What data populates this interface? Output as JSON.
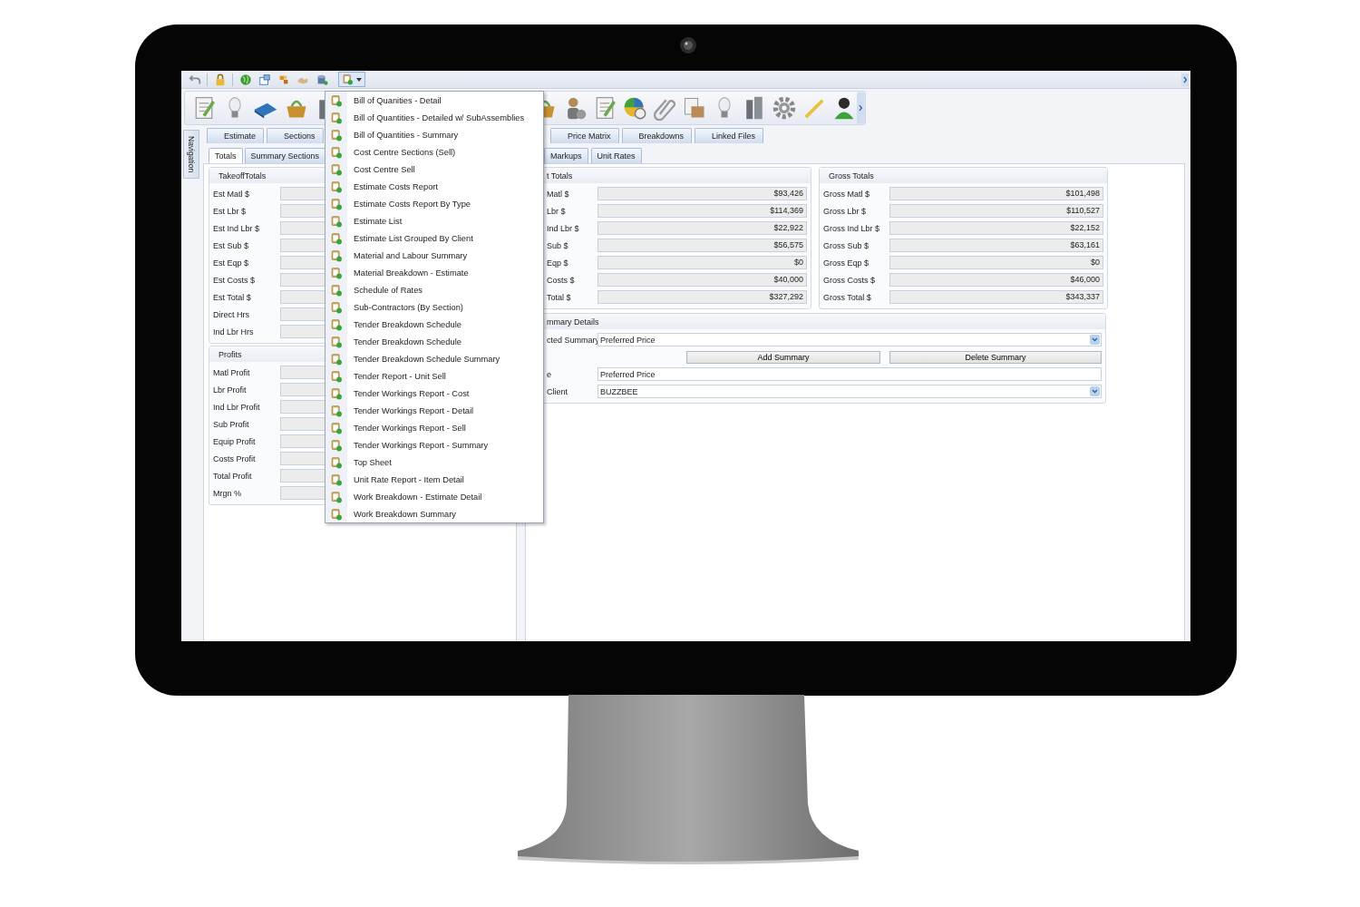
{
  "report_menu": {
    "expanded": true,
    "items": [
      {
        "label": "Bill of Quanities - Detail"
      },
      {
        "label": "Bill of Quantities - Detailed w/ SubAssemblies"
      },
      {
        "label": "Bill of Quantities - Summary"
      },
      {
        "label": "Cost Centre Sections (Sell)"
      },
      {
        "label": "Cost Centre Sell"
      },
      {
        "label": "Estimate Costs Report"
      },
      {
        "label": "Estimate Costs Report By Type"
      },
      {
        "label": "Estimate List"
      },
      {
        "label": "Estimate List Grouped By Client"
      },
      {
        "label": "Material and Labour Summary"
      },
      {
        "label": "Material Breakdown - Estimate"
      },
      {
        "label": "Schedule of Rates"
      },
      {
        "label": "Sub-Contractors (By Section)"
      },
      {
        "label": "Tender Breakdown Schedule"
      },
      {
        "label": "Tender Breakdown Schedule"
      },
      {
        "label": "Tender Breakdown Schedule Summary"
      },
      {
        "label": "Tender Report - Unit Sell"
      },
      {
        "label": "Tender Workings Report - Cost"
      },
      {
        "label": "Tender Workings Report - Detail"
      },
      {
        "label": "Tender Workings Report - Sell"
      },
      {
        "label": "Tender Workings Report - Summary"
      },
      {
        "label": "Top Sheet"
      },
      {
        "label": "Unit Rate Report - Item Detail"
      },
      {
        "label": "Work Breakdown - Estimate Detail"
      },
      {
        "label": "Work Breakdown Summary"
      }
    ]
  },
  "navigation_tab": "Navigation",
  "main_tabs_left": [
    {
      "label": "Estimate",
      "selected": false
    },
    {
      "label": "Sections",
      "selected": false
    }
  ],
  "main_tabs_right": [
    {
      "label": "Price Matrix",
      "selected": false
    },
    {
      "label": "Breakdowns",
      "selected": false
    },
    {
      "label": "Linked Files",
      "selected": false
    }
  ],
  "sub_tabs_left": [
    {
      "label": "Totals",
      "selected": true
    },
    {
      "label": "Summary Sections",
      "selected": false
    }
  ],
  "sub_tabs_right": [
    {
      "label": "Markups",
      "selected": false
    },
    {
      "label": "Unit Rates",
      "selected": false
    }
  ],
  "takeoff_totals": {
    "title": "TakeoffTotals",
    "fields": [
      {
        "label": "Est Matl $"
      },
      {
        "label": "Est Lbr $"
      },
      {
        "label": "Est Ind Lbr $"
      },
      {
        "label": "Est Sub $"
      },
      {
        "label": "Est Eqp $"
      },
      {
        "label": "Est Costs $"
      },
      {
        "label": "Est Total $"
      },
      {
        "label": "Direct Hrs"
      },
      {
        "label": "Ind Lbr Hrs"
      }
    ]
  },
  "profits": {
    "title": "Profits",
    "fields": [
      {
        "label": "Matl Profit"
      },
      {
        "label": "Lbr Profit"
      },
      {
        "label": "Ind Lbr Profit"
      },
      {
        "label": "Sub Profit"
      },
      {
        "label": "Equip Profit"
      },
      {
        "label": "Costs Profit"
      },
      {
        "label": "Total Profit"
      },
      {
        "label": "Mrgn %"
      }
    ]
  },
  "totals": {
    "title": "t Totals",
    "fields": [
      {
        "label": "Matl $",
        "value": "$93,426"
      },
      {
        "label": "Lbr $",
        "value": "$114,369"
      },
      {
        "label": "Ind Lbr $",
        "value": "$22,922"
      },
      {
        "label": "Sub $",
        "value": "$56,575"
      },
      {
        "label": "Eqp $",
        "value": "$0"
      },
      {
        "label": "Costs $",
        "value": "$40,000"
      },
      {
        "label": "Total $",
        "value": "$327,292"
      }
    ]
  },
  "gross_totals": {
    "title": "Gross Totals",
    "fields": [
      {
        "label": "Gross Matl $",
        "value": "$101,498"
      },
      {
        "label": "Gross Lbr $",
        "value": "$110,527"
      },
      {
        "label": "Gross Ind Lbr $",
        "value": "$22,152"
      },
      {
        "label": "Gross Sub $",
        "value": "$63,161"
      },
      {
        "label": "Gross Eqp $",
        "value": "$0"
      },
      {
        "label": "Gross Costs $",
        "value": "$46,000"
      },
      {
        "label": "Gross Total $",
        "value": "$343,337"
      }
    ]
  },
  "summary_details": {
    "title": "mmary Details",
    "selected_summary": {
      "label": "cted Summary",
      "value": "Preferred Price"
    },
    "buttons": [
      "Add Summary",
      "Delete Summary"
    ],
    "name_field": {
      "label": "e",
      "value": "Preferred Price"
    },
    "client": {
      "label": "Client",
      "value": "BUZZBEE"
    }
  }
}
